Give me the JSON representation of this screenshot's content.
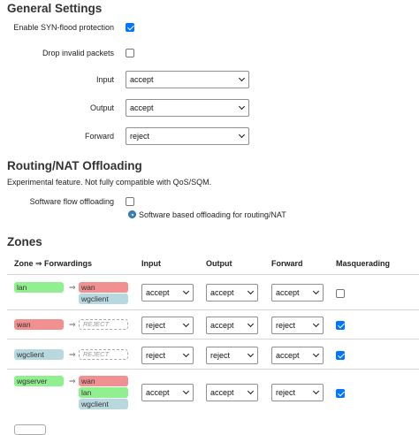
{
  "general": {
    "title": "General Settings",
    "synflood_label": "Enable SYN-flood protection",
    "synflood_checked": true,
    "drop_invalid_label": "Drop invalid packets",
    "drop_invalid_checked": false,
    "input_label": "Input",
    "input_value": "accept",
    "output_label": "Output",
    "output_value": "accept",
    "forward_label": "Forward",
    "forward_value": "reject"
  },
  "offloading": {
    "title": "Routing/NAT Offloading",
    "description": "Experimental feature. Not fully compatible with QoS/SQM.",
    "software_label": "Software flow offloading",
    "software_checked": false,
    "hint": "Software based offloading for routing/NAT"
  },
  "zones": {
    "title": "Zones",
    "columns": {
      "zone": "Zone ⇒ Forwardings",
      "input": "Input",
      "output": "Output",
      "forward": "Forward",
      "masq": "Masquerading"
    },
    "arrow": "⇒",
    "rows": [
      {
        "zone": "lan",
        "targets": [
          "wan",
          "wgclient"
        ],
        "input": "accept",
        "output": "accept",
        "forward": "accept",
        "masquerading": false
      },
      {
        "zone": "wan",
        "reject_label": "REJECT",
        "input": "reject",
        "output": "accept",
        "forward": "reject",
        "masquerading": true
      },
      {
        "zone": "wgclient",
        "reject_label": "REJECT",
        "input": "reject",
        "output": "reject",
        "forward": "accept",
        "masquerading": true
      },
      {
        "zone": "wgserver",
        "targets": [
          "wan",
          "lan",
          "wgclient"
        ],
        "input": "accept",
        "output": "accept",
        "forward": "reject",
        "masquerading": true
      }
    ]
  },
  "colors": {
    "zone_lan": "#90f090",
    "zone_wan": "#f09090",
    "zone_wgclient": "#b8d8e0",
    "checkbox_checked": "#0075ff"
  }
}
